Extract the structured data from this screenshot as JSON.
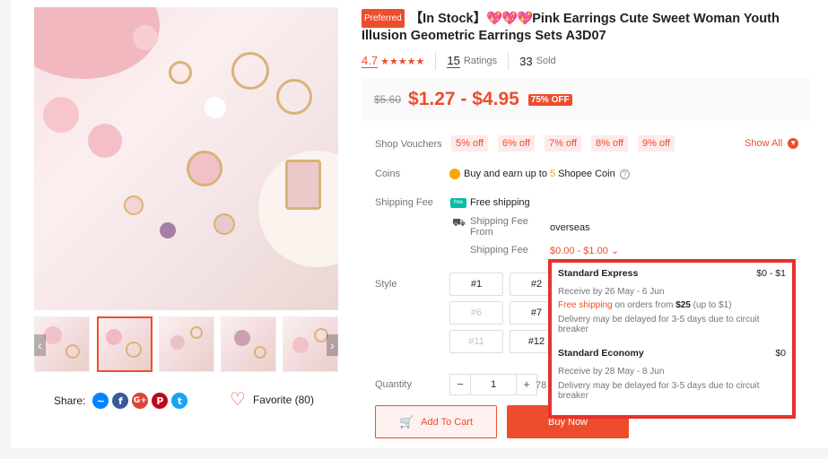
{
  "product": {
    "preferred_badge": "Preferred",
    "title_prefix": "【In Stock】",
    "title_hearts": "💖💖💖",
    "title_main": "Pink Earrings Cute Sweet Woman Youth Illusion Geometric Earrings Sets A3D07",
    "rating": "4.7",
    "ratings_count": "15",
    "ratings_label": "Ratings",
    "sold_count": "33",
    "sold_label": "Sold"
  },
  "price": {
    "original": "$5.60",
    "range": "$1.27 - $4.95",
    "discount": "75% OFF"
  },
  "vouchers": {
    "label": "Shop Vouchers",
    "items": [
      "5% off",
      "6% off",
      "7% off",
      "8% off",
      "9% off"
    ],
    "show_all": "Show All"
  },
  "coins": {
    "label": "Coins",
    "pre": "Buy and earn up to",
    "amount": "5",
    "post": "Shopee Coin"
  },
  "shipping": {
    "label": "Shipping Fee",
    "free_badge": "free",
    "free_text": "Free shipping",
    "from_label": "Shipping Fee From",
    "from_value": "overseas",
    "fee_label": "Shipping Fee",
    "fee_value": "$0.00 - $1.00"
  },
  "style": {
    "label": "Style",
    "options": [
      {
        "label": "#1",
        "disabled": false
      },
      {
        "label": "#2",
        "disabled": false
      },
      {
        "label": "#6",
        "disabled": true
      },
      {
        "label": "#7",
        "disabled": false
      },
      {
        "label": "#11",
        "disabled": true
      },
      {
        "label": "#12",
        "disabled": false
      }
    ]
  },
  "quantity": {
    "label": "Quantity",
    "minus": "−",
    "value": "1",
    "plus": "+",
    "stock": "78"
  },
  "actions": {
    "add_to_cart": "Add To Cart",
    "buy_now": "Buy Now"
  },
  "share": {
    "label": "Share:",
    "favorite": "Favorite (80)"
  },
  "popup": {
    "express_title": "Standard Express",
    "express_range": "$0 - $1",
    "express_receive": "Receive by 26 May - 6 Jun",
    "express_free_a": "Free shipping",
    "express_free_b": "on orders from",
    "express_free_amount": "$25",
    "express_free_c": "(up to $1)",
    "express_delay": "Delivery may be delayed for 3-5 days due to circuit breaker",
    "economy_title": "Standard Economy",
    "economy_range": "$0",
    "economy_receive": "Receive by 28 May - 8 Jun",
    "economy_delay": "Delivery may be delayed for 3-5 days due to circuit breaker"
  },
  "colors": {
    "accent": "#ee4d2d",
    "popup_border": "#e5322d",
    "coin": "#f6a700",
    "free_ship": "#00bfa5"
  }
}
